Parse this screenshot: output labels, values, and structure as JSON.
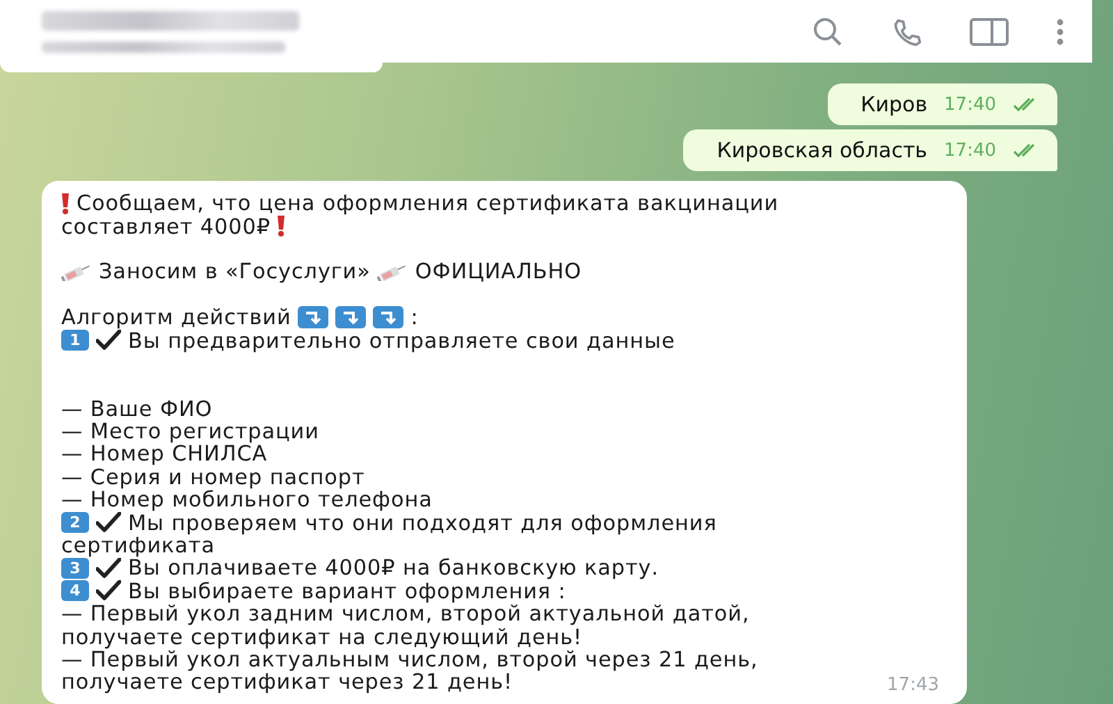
{
  "header": {
    "name_blurred": true,
    "actions": [
      {
        "kind": "search"
      },
      {
        "kind": "phone"
      },
      {
        "kind": "sidebar"
      },
      {
        "kind": "more"
      }
    ]
  },
  "outgoing": [
    {
      "text": "Киров",
      "time": "17:40",
      "read": true
    },
    {
      "text": "Кировская область",
      "time": "17:40",
      "read": true
    }
  ],
  "incoming": {
    "time": "17:43",
    "lines": [
      {
        "kind": "text",
        "parts": [
          {
            "kind": "alert"
          },
          {
            "kind": "text",
            "text": "Сообщаем, что цена оформления сертификата вакцинации"
          }
        ]
      },
      {
        "kind": "text",
        "parts": [
          {
            "kind": "text",
            "text": "составляет 4000₽"
          },
          {
            "kind": "alert"
          }
        ]
      },
      {
        "kind": "blank"
      },
      {
        "kind": "text",
        "parts": [
          {
            "kind": "syringe"
          },
          {
            "kind": "text",
            "text": "Заносим в «Госуслуги»"
          },
          {
            "kind": "syringe"
          },
          {
            "kind": "text",
            "text": "ОФИЦИАЛЬНО"
          }
        ]
      },
      {
        "kind": "blank"
      },
      {
        "kind": "text",
        "parts": [
          {
            "kind": "text",
            "text": "Алгоритм действий"
          },
          {
            "kind": "arrow"
          },
          {
            "kind": "arrow"
          },
          {
            "kind": "arrow"
          },
          {
            "kind": "text",
            "text": ":"
          }
        ]
      },
      {
        "kind": "text",
        "parts": [
          {
            "kind": "number",
            "text": "1"
          },
          {
            "kind": "check"
          },
          {
            "kind": "text",
            "text": "Вы предварительно отправляете свои данные"
          }
        ]
      },
      {
        "kind": "blank"
      },
      {
        "kind": "blank"
      },
      {
        "kind": "text",
        "parts": [
          {
            "kind": "text",
            "text": "— Ваше ФИО"
          }
        ]
      },
      {
        "kind": "text",
        "parts": [
          {
            "kind": "text",
            "text": "— Место регистрации"
          }
        ]
      },
      {
        "kind": "text",
        "parts": [
          {
            "kind": "text",
            "text": "— Номер СНИЛСА"
          }
        ]
      },
      {
        "kind": "text",
        "parts": [
          {
            "kind": "text",
            "text": "— Серия и номер паспорт"
          }
        ]
      },
      {
        "kind": "text",
        "parts": [
          {
            "kind": "text",
            "text": "— Номер мобильного телефона"
          }
        ]
      },
      {
        "kind": "text",
        "parts": [
          {
            "kind": "number",
            "text": "2"
          },
          {
            "kind": "check"
          },
          {
            "kind": "text",
            "text": "Мы проверяем что они подходят для оформления"
          }
        ]
      },
      {
        "kind": "text",
        "parts": [
          {
            "kind": "text",
            "text": "сертификата"
          }
        ]
      },
      {
        "kind": "text",
        "parts": [
          {
            "kind": "number",
            "text": "3"
          },
          {
            "kind": "check"
          },
          {
            "kind": "text",
            "text": "Вы оплачиваете 4000₽ на банковскую карту."
          }
        ]
      },
      {
        "kind": "text",
        "parts": [
          {
            "kind": "number",
            "text": "4"
          },
          {
            "kind": "check"
          },
          {
            "kind": "text",
            "text": "Вы выбираете вариант оформления :"
          }
        ]
      },
      {
        "kind": "text",
        "parts": [
          {
            "kind": "text",
            "text": "— Первый укол задним числом, второй актуальной датой,"
          }
        ]
      },
      {
        "kind": "text",
        "parts": [
          {
            "kind": "text",
            "text": "получаете сертификат на следующий день!"
          }
        ]
      },
      {
        "kind": "text",
        "parts": [
          {
            "kind": "text",
            "text": "— Первый укол актуальным числом, второй через 21 день,"
          }
        ]
      },
      {
        "kind": "text",
        "parts": [
          {
            "kind": "text",
            "text": "получаете сертификат через 21 день!"
          }
        ]
      }
    ]
  }
}
